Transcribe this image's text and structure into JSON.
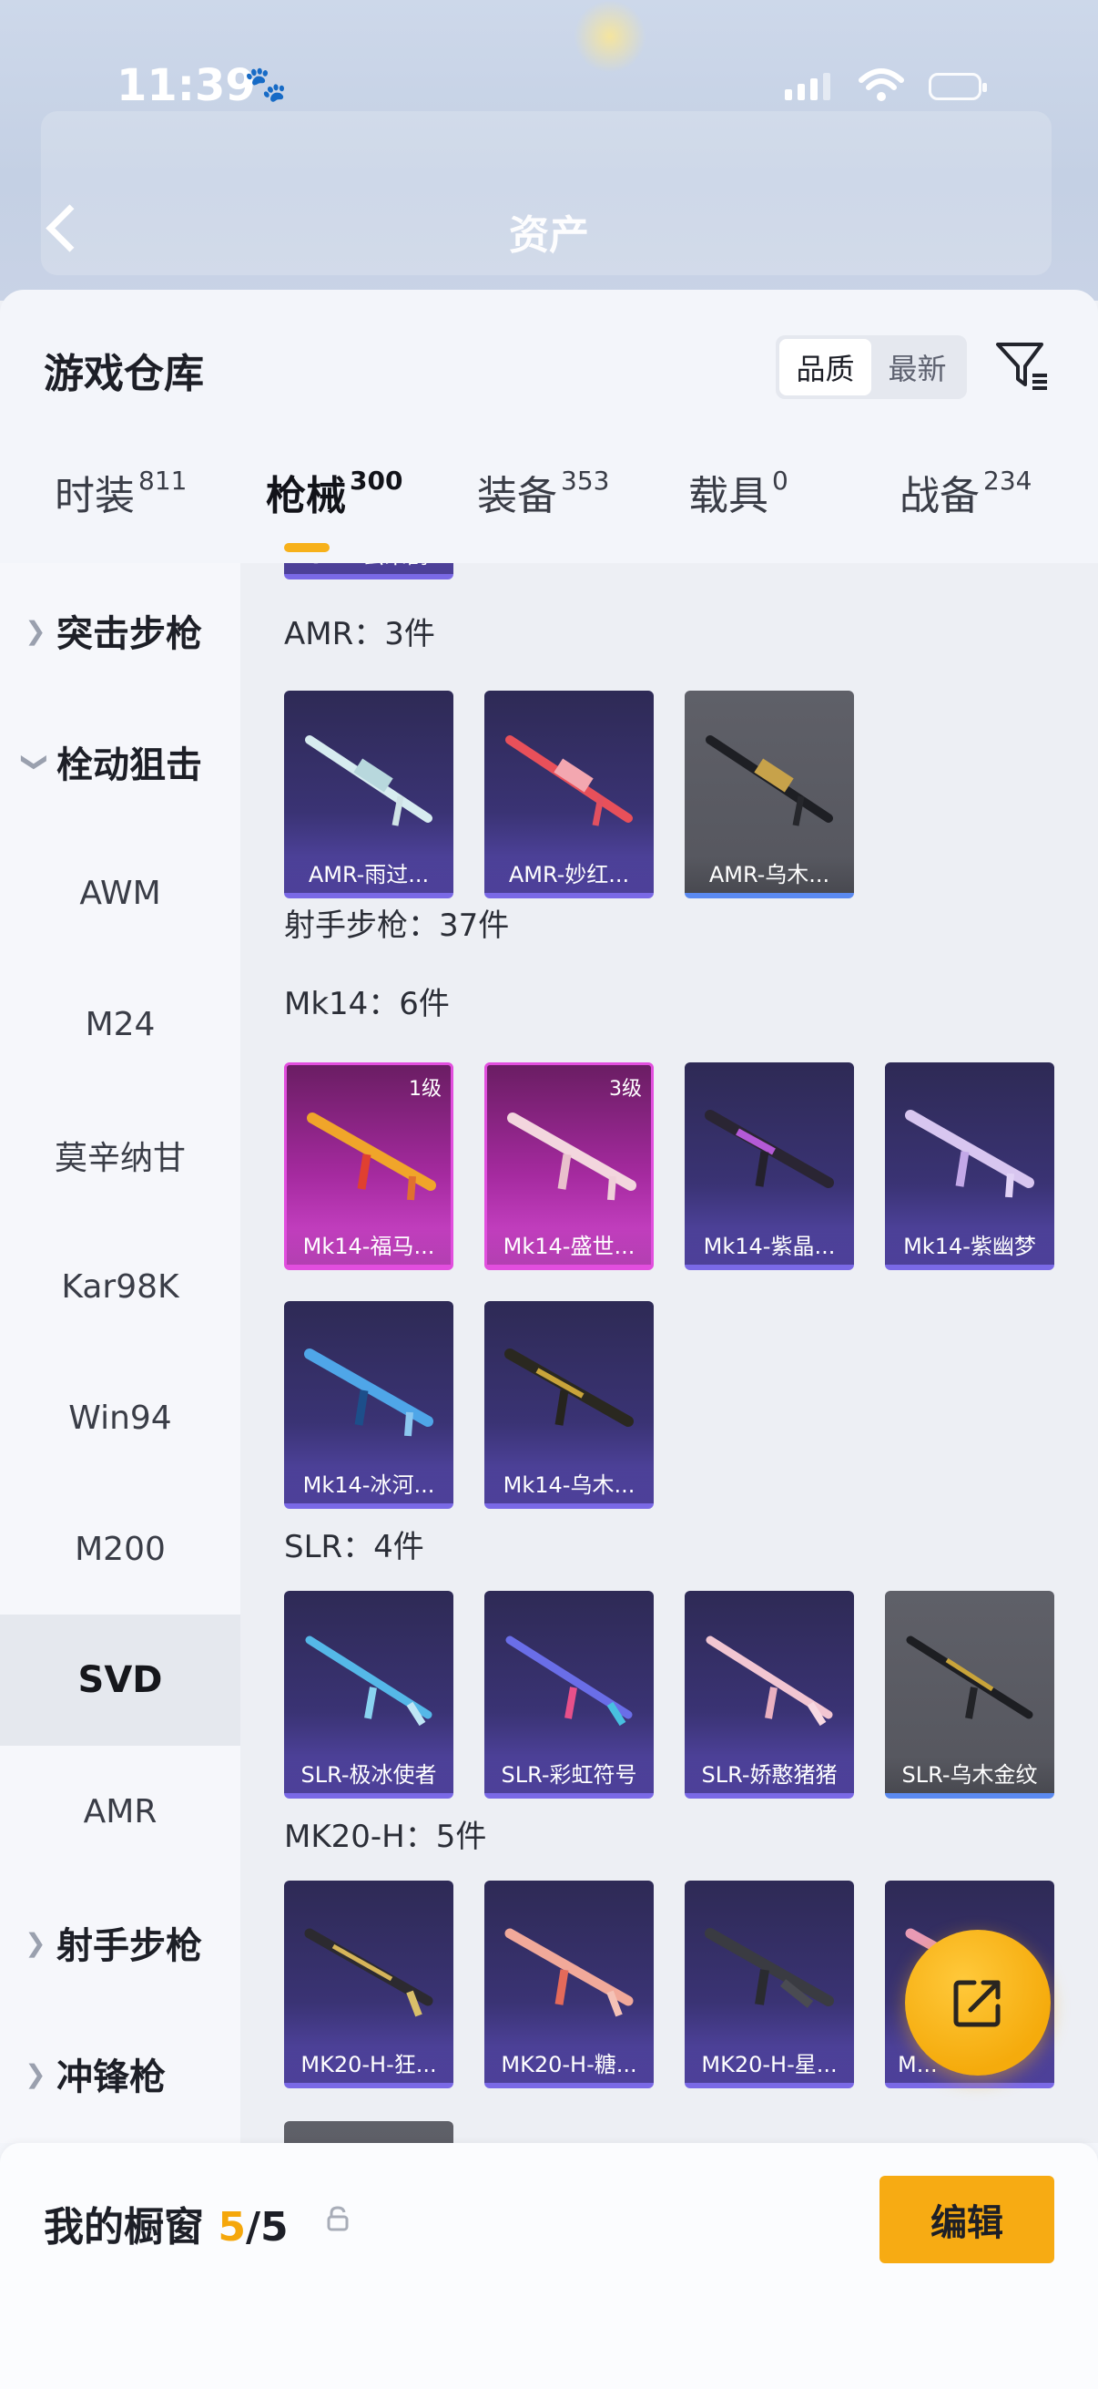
{
  "status_bar": {
    "time": "11:39"
  },
  "header": {
    "title": "资产"
  },
  "warehouse": {
    "title": "游戏仓库",
    "sort_options": [
      "品质",
      "最新"
    ],
    "tabs": [
      {
        "label": "时装",
        "count": "811"
      },
      {
        "label": "枪械",
        "count": "300"
      },
      {
        "label": "装备",
        "count": "353"
      },
      {
        "label": "载具",
        "count": "0"
      },
      {
        "label": "战备",
        "count": "234"
      }
    ]
  },
  "sidebar": {
    "items": [
      {
        "label": "突击步枪"
      },
      {
        "label": "栓动狙击"
      },
      {
        "label": "AWM"
      },
      {
        "label": "M24"
      },
      {
        "label": "莫辛纳甘"
      },
      {
        "label": "Kar98K"
      },
      {
        "label": "Win94"
      },
      {
        "label": "M200"
      },
      {
        "label": "SVD"
      },
      {
        "label": "AMR"
      },
      {
        "label": "射手步枪"
      },
      {
        "label": "冲锋枪"
      }
    ]
  },
  "content": {
    "partial_top_card": "SVD-云朵鹤",
    "sections": [
      {
        "label": "AMR：3件"
      },
      {
        "label": "射手步枪：37件"
      },
      {
        "label": "Mk14：6件"
      },
      {
        "label": "SLR：4件"
      },
      {
        "label": "MK20-H：5件"
      }
    ],
    "amr_cards": [
      "AMR-雨过...",
      "AMR-妙红...",
      "AMR-乌木..."
    ],
    "mk14_cards": [
      "Mk14-福马...",
      "Mk14-盛世...",
      "Mk14-紫晶...",
      "Mk14-紫幽梦",
      "Mk14-冰河...",
      "Mk14-乌木..."
    ],
    "mk14_levels": [
      "1级",
      "3级"
    ],
    "slr_cards": [
      "SLR-极冰使者",
      "SLR-彩虹符号",
      "SLR-娇憨猪猪",
      "SLR-乌木金纹"
    ],
    "mk20_cards": [
      "MK20-H-狂...",
      "MK20-H-糖...",
      "MK20-H-星...",
      "M..."
    ]
  },
  "showcase": {
    "label": "我的橱窗",
    "current": "5",
    "separator": "/",
    "total": "5",
    "edit_label": "编辑"
  },
  "colors": {
    "accent": "#f7ab13",
    "purple_card": "#3a3374",
    "pink_card": "#a52a9f",
    "grey_card": "#5f6068"
  }
}
